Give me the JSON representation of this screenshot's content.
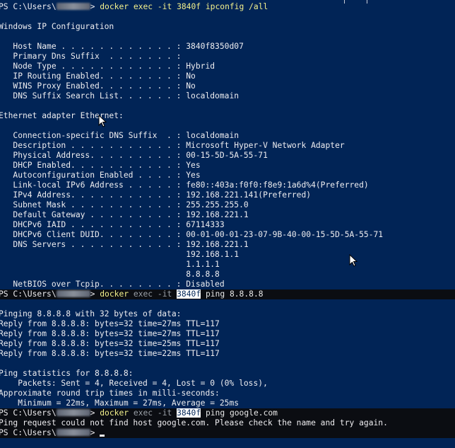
{
  "prompt": {
    "prefix": "PS C:\\Users\\",
    "suffix": ">"
  },
  "commands": {
    "first": "docker exec -it 3840f ipconfig /all",
    "second": {
      "word": "docker",
      "exec": "exec",
      "flag": "-it",
      "container": "3840f",
      "args": "ping 8.8.8.8"
    },
    "third": {
      "word": "docker",
      "exec": "exec",
      "flag": "-it",
      "container": "3840f",
      "args": "ping google.com"
    }
  },
  "ipconfig": {
    "title": "Windows IP Configuration",
    "host_name": "   Host Name . . . . . . . . . . . . : 3840f8350d07",
    "primary_dns": "   Primary Dns Suffix  . . . . . . . :",
    "node_type": "   Node Type . . . . . . . . . . . . : Hybrid",
    "ip_routing": "   IP Routing Enabled. . . . . . . . : No",
    "wins_proxy": "   WINS Proxy Enabled. . . . . . . . : No",
    "dns_search": "   DNS Suffix Search List. . . . . . : localdomain",
    "adapter_title": "Ethernet adapter Ethernet:",
    "conn_dns": "   Connection-specific DNS Suffix  . : localdomain",
    "description": "   Description . . . . . . . . . . . : Microsoft Hyper-V Network Adapter",
    "physical": "   Physical Address. . . . . . . . . : 00-15-5D-5A-55-71",
    "dhcp": "   DHCP Enabled. . . . . . . . . . . : Yes",
    "autoconf": "   Autoconfiguration Enabled . . . . : Yes",
    "ipv6": "   Link-local IPv6 Address . . . . . : fe80::403a:f0f0:f8e9:1a6d%4(Preferred)",
    "ipv4": "   IPv4 Address. . . . . . . . . . . : 192.168.221.141(Preferred)",
    "subnet": "   Subnet Mask . . . . . . . . . . . : 255.255.255.0",
    "gateway": "   Default Gateway . . . . . . . . . : 192.168.221.1",
    "dhcpv6_iaid": "   DHCPv6 IAID . . . . . . . . . . . : 67114333",
    "dhcpv6_duid": "   DHCPv6 Client DUID. . . . . . . . : 00-01-00-01-23-07-9B-40-00-15-5D-5A-55-71",
    "dns_servers": "   DNS Servers . . . . . . . . . . . : 192.168.221.1",
    "dns_2": "                                       192.168.1.1",
    "dns_3": "                                       1.1.1.1",
    "dns_4": "                                       8.8.8.8",
    "netbios": "   NetBIOS over Tcpip. . . . . . . . : Disabled"
  },
  "ping": {
    "header": "Pinging 8.8.8.8 with 32 bytes of data:",
    "replies": [
      "Reply from 8.8.8.8: bytes=32 time=27ms TTL=117",
      "Reply from 8.8.8.8: bytes=32 time=27ms TTL=117",
      "Reply from 8.8.8.8: bytes=32 time=25ms TTL=117",
      "Reply from 8.8.8.8: bytes=32 time=22ms TTL=117"
    ],
    "stats_title": "Ping statistics for 8.8.8.8:",
    "stats_packets": "    Packets: Sent = 4, Received = 4, Lost = 0 (0% loss),",
    "approx": "Approximate round trip times in milli-seconds:",
    "minmax": "    Minimum = 22ms, Maximum = 27ms, Average = 25ms",
    "error": "Ping request could not find host google.com. Please check the name and try again."
  },
  "colors": {
    "background": "#012456",
    "highlight": "#0b0d12",
    "command": "#f3f08c",
    "text": "#eeedf0"
  }
}
